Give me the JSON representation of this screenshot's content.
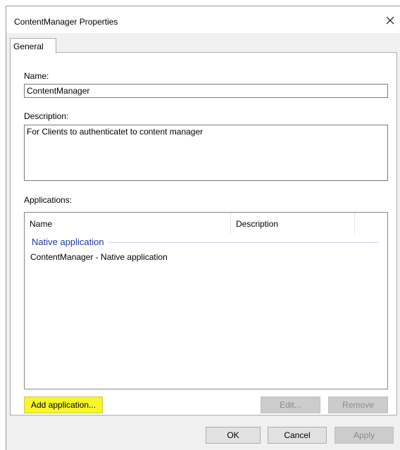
{
  "window": {
    "title": "ContentManager Properties",
    "close_glyph": "✕"
  },
  "tabs": [
    {
      "label": "General",
      "active": true
    }
  ],
  "form": {
    "name_label": "Name:",
    "name_value": "ContentManager",
    "description_label": "Description:",
    "description_value": "For Clients to authenticatet to content manager",
    "applications_label": "Applications:"
  },
  "applications_list": {
    "columns": [
      "Name",
      "Description"
    ],
    "groups": [
      {
        "label": "Native application",
        "items": [
          "ContentManager - Native application"
        ]
      }
    ]
  },
  "panel_buttons": {
    "add": "Add application...",
    "edit": "Edit...",
    "remove": "Remove"
  },
  "dialog_buttons": {
    "ok": "OK",
    "cancel": "Cancel",
    "apply": "Apply"
  },
  "colors": {
    "group_header": "#1e3aa8",
    "highlight": "#f6f62a"
  }
}
